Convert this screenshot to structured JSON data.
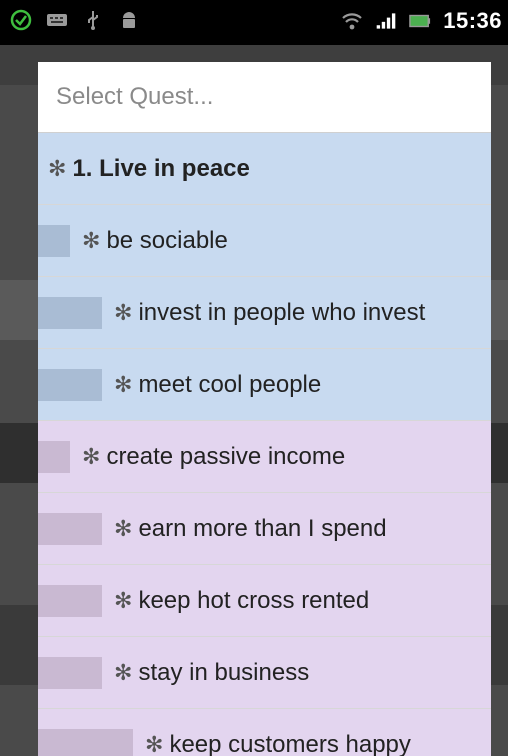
{
  "status_bar": {
    "time": "15:36",
    "icons": [
      "check-circle-icon",
      "keyboard-icon",
      "usb-icon",
      "android-icon",
      "wifi-icon",
      "signal-icon",
      "battery-icon"
    ]
  },
  "dialog": {
    "placeholder": "Select Quest...",
    "bullet": "✻",
    "items": [
      {
        "label": "1. Live in peace",
        "level": 0,
        "color": "blue",
        "bold": true
      },
      {
        "label": "be sociable",
        "level": 1,
        "color": "blue",
        "bold": false
      },
      {
        "label": "invest in people who invest",
        "level": 2,
        "color": "blue",
        "bold": false
      },
      {
        "label": "meet cool people",
        "level": 2,
        "color": "blue",
        "bold": false
      },
      {
        "label": "create passive income",
        "level": 1,
        "color": "purple",
        "bold": false
      },
      {
        "label": "earn more than I spend",
        "level": 2,
        "color": "purple",
        "bold": false
      },
      {
        "label": "keep hot cross rented",
        "level": 2,
        "color": "purple",
        "bold": false
      },
      {
        "label": "stay in business",
        "level": 2,
        "color": "purple",
        "bold": false
      },
      {
        "label": "keep customers happy",
        "level": 3,
        "color": "purple",
        "bold": false
      }
    ]
  },
  "colors": {
    "blue_row": "#c8daf0",
    "purple_row": "#e3d5ef"
  }
}
